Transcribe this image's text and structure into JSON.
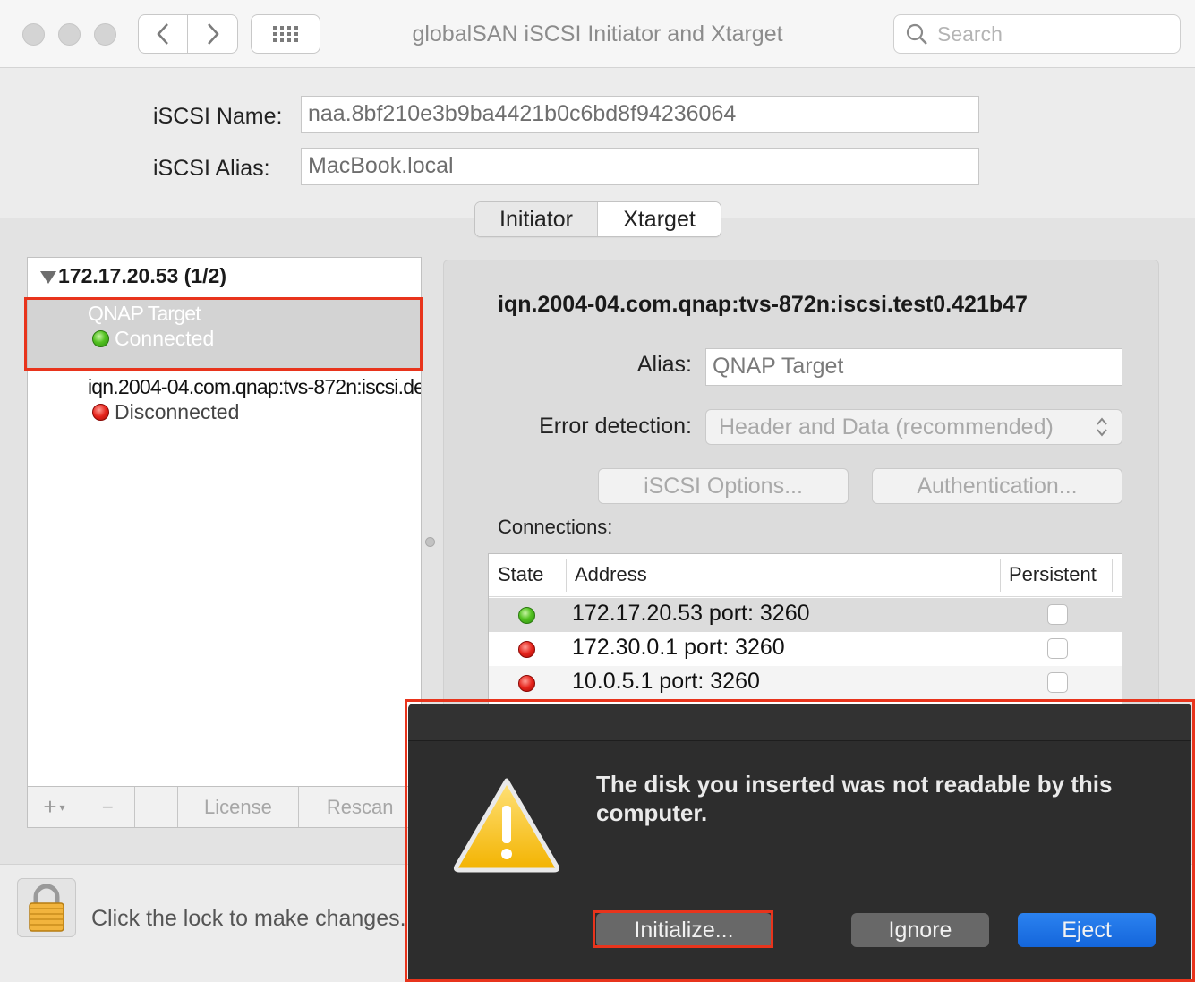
{
  "window": {
    "title": "globalSAN iSCSI Initiator and Xtarget",
    "search_placeholder": "Search"
  },
  "identity": {
    "name_label": "iSCSI Name:",
    "name_value": "naa.8bf210e3b9ba4421b0c6bd8f94236064",
    "alias_label": "iSCSI Alias:",
    "alias_value": "MacBook.local"
  },
  "tabs": {
    "initiator": "Initiator",
    "xtarget": "Xtarget"
  },
  "target_list": {
    "group_label": "172.17.20.53 (1/2)",
    "items": [
      {
        "title": "QNAP Target",
        "status": "Connected",
        "status_color": "green"
      },
      {
        "title": "iqn.2004-04.com.qnap:tvs-872n:iscsi.de…",
        "status": "Disconnected",
        "status_color": "red"
      }
    ],
    "toolbar": {
      "add": "+",
      "remove": "−",
      "license": "License",
      "rescan": "Rescan"
    }
  },
  "detail": {
    "iqn": "iqn.2004-04.com.qnap:tvs-872n:iscsi.test0.421b47",
    "alias_label": "Alias:",
    "alias_value": "QNAP Target",
    "error_label": "Error detection:",
    "error_value": "Header and Data (recommended)",
    "options_button": "iSCSI Options...",
    "auth_button": "Authentication...",
    "connections_label": "Connections:",
    "columns": {
      "state": "State",
      "address": "Address",
      "persistent": "Persistent"
    },
    "connections": [
      {
        "address": "172.17.20.53 port: 3260",
        "state": "green",
        "persistent": false
      },
      {
        "address": "172.30.0.1 port: 3260",
        "state": "red",
        "persistent": false
      },
      {
        "address": "10.0.5.1 port: 3260",
        "state": "red",
        "persistent": false
      }
    ]
  },
  "lock": {
    "text": "Click the lock to make changes."
  },
  "alert": {
    "message": "The disk you inserted was not readable by this computer.",
    "initialize": "Initialize...",
    "ignore": "Ignore",
    "eject": "Eject"
  },
  "colors": {
    "highlight": "#e8341c",
    "primary_button": "#1a6fe6",
    "dialog_bg": "#2d2d2d"
  }
}
